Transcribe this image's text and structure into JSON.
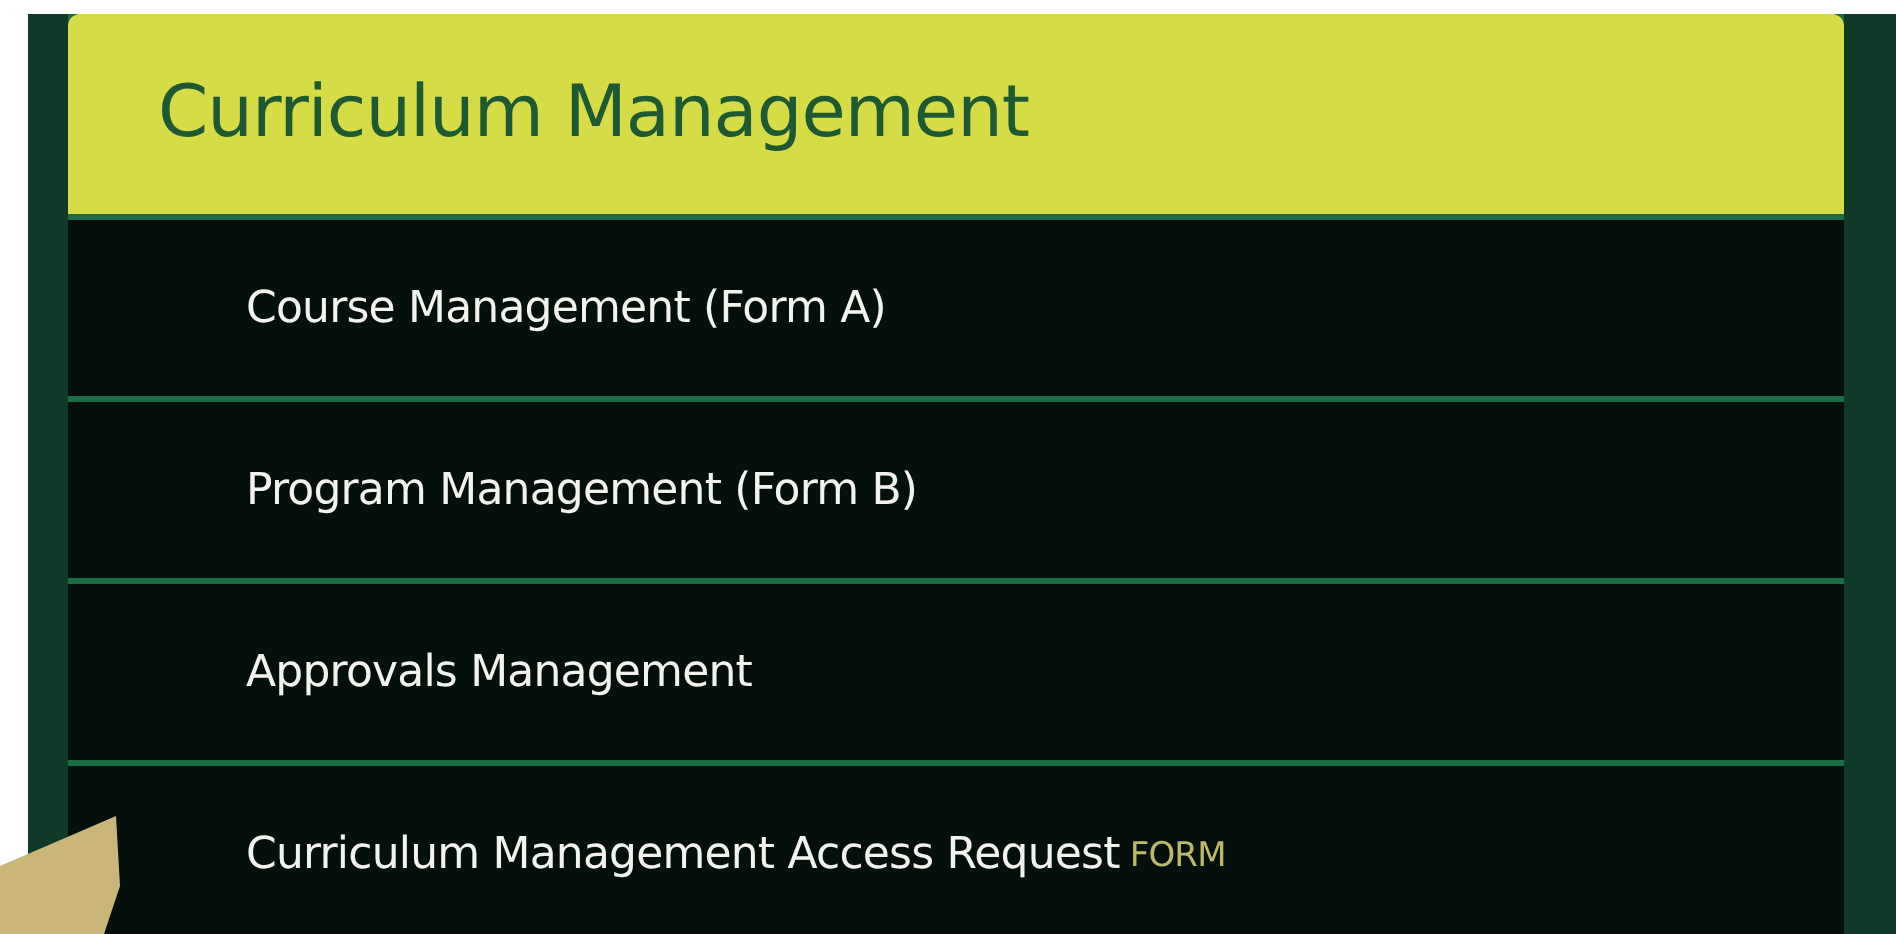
{
  "menu": {
    "title": "Curriculum Management",
    "items": [
      {
        "label": "Course Management (Form A)"
      },
      {
        "label": "Program Management (Form B)"
      },
      {
        "label": "Approvals Management"
      },
      {
        "label": "Curriculum Management Access Request",
        "tag": "FORM"
      }
    ]
  }
}
